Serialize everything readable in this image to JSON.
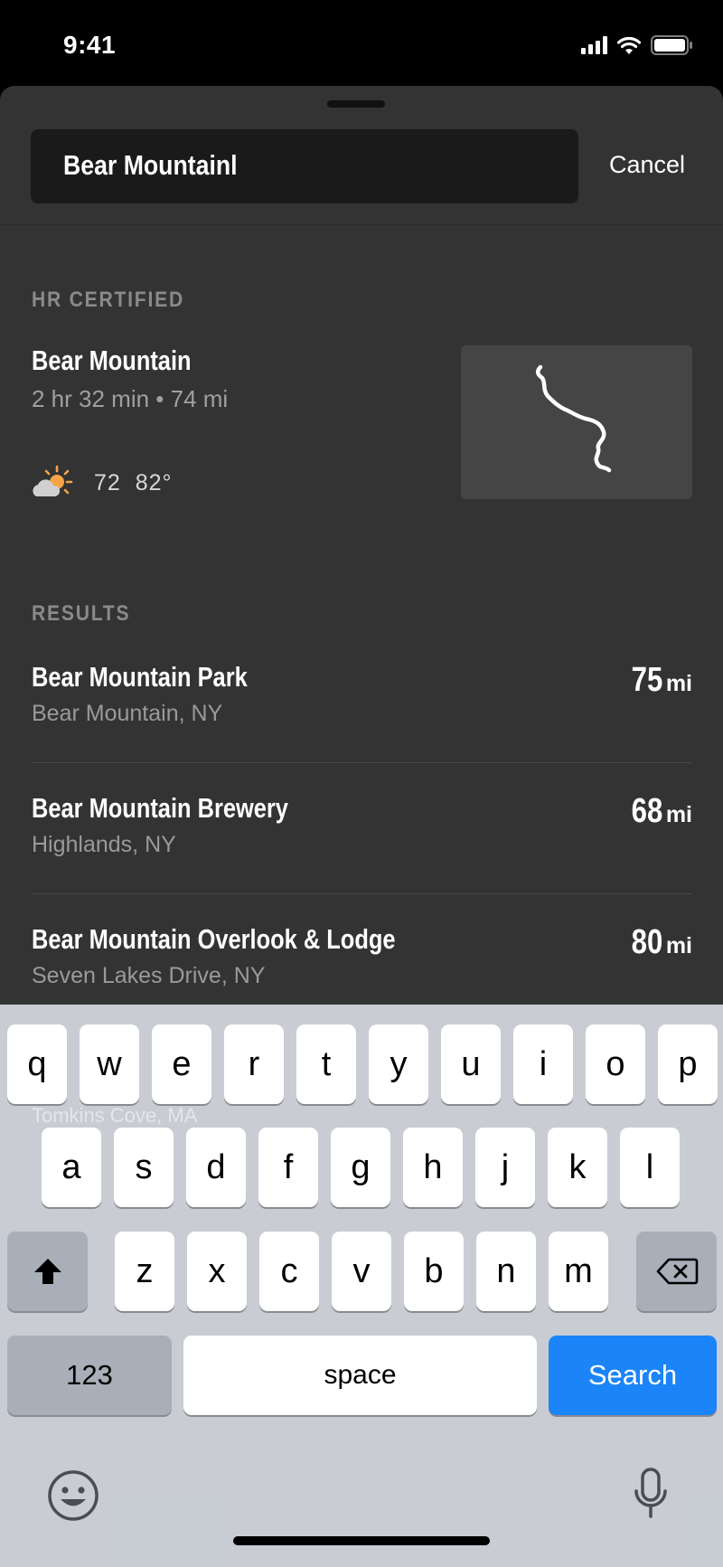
{
  "status_bar": {
    "time": "9:41"
  },
  "search": {
    "query": "Bear Mountainl",
    "cancel_label": "Cancel"
  },
  "certified": {
    "section_title": "HR CERTIFIED",
    "name": "Bear Mountain",
    "meta": "2 hr 32 min • 74 mi",
    "temps": "72  82°",
    "weather_icon": "partly-sunny-icon"
  },
  "results": {
    "section_title": "RESULTS",
    "unit": "mi",
    "items": [
      {
        "name": "Bear Mountain Park",
        "location": "Bear Mountain, NY",
        "distance": "75"
      },
      {
        "name": "Bear Mountain Brewery",
        "location": "Highlands, NY",
        "distance": "68"
      },
      {
        "name": "Bear Mountain Overlook & Lodge",
        "location": "Seven Lakes Drive, NY",
        "distance": "80"
      }
    ],
    "partial_item_location": "Tomkins Cove, MA"
  },
  "keyboard": {
    "row1": [
      "q",
      "w",
      "e",
      "r",
      "t",
      "y",
      "u",
      "i",
      "o",
      "p"
    ],
    "row2": [
      "a",
      "s",
      "d",
      "f",
      "g",
      "h",
      "j",
      "k",
      "l"
    ],
    "row3": [
      "z",
      "x",
      "c",
      "v",
      "b",
      "n",
      "m"
    ],
    "numbers_label": "123",
    "space_label": "space",
    "search_label": "Search"
  },
  "colors": {
    "sheet_background": "#333333",
    "search_field": "#1a1a1a",
    "accent_blue": "#1b84f8",
    "keyboard_background": "#ced2d9"
  }
}
